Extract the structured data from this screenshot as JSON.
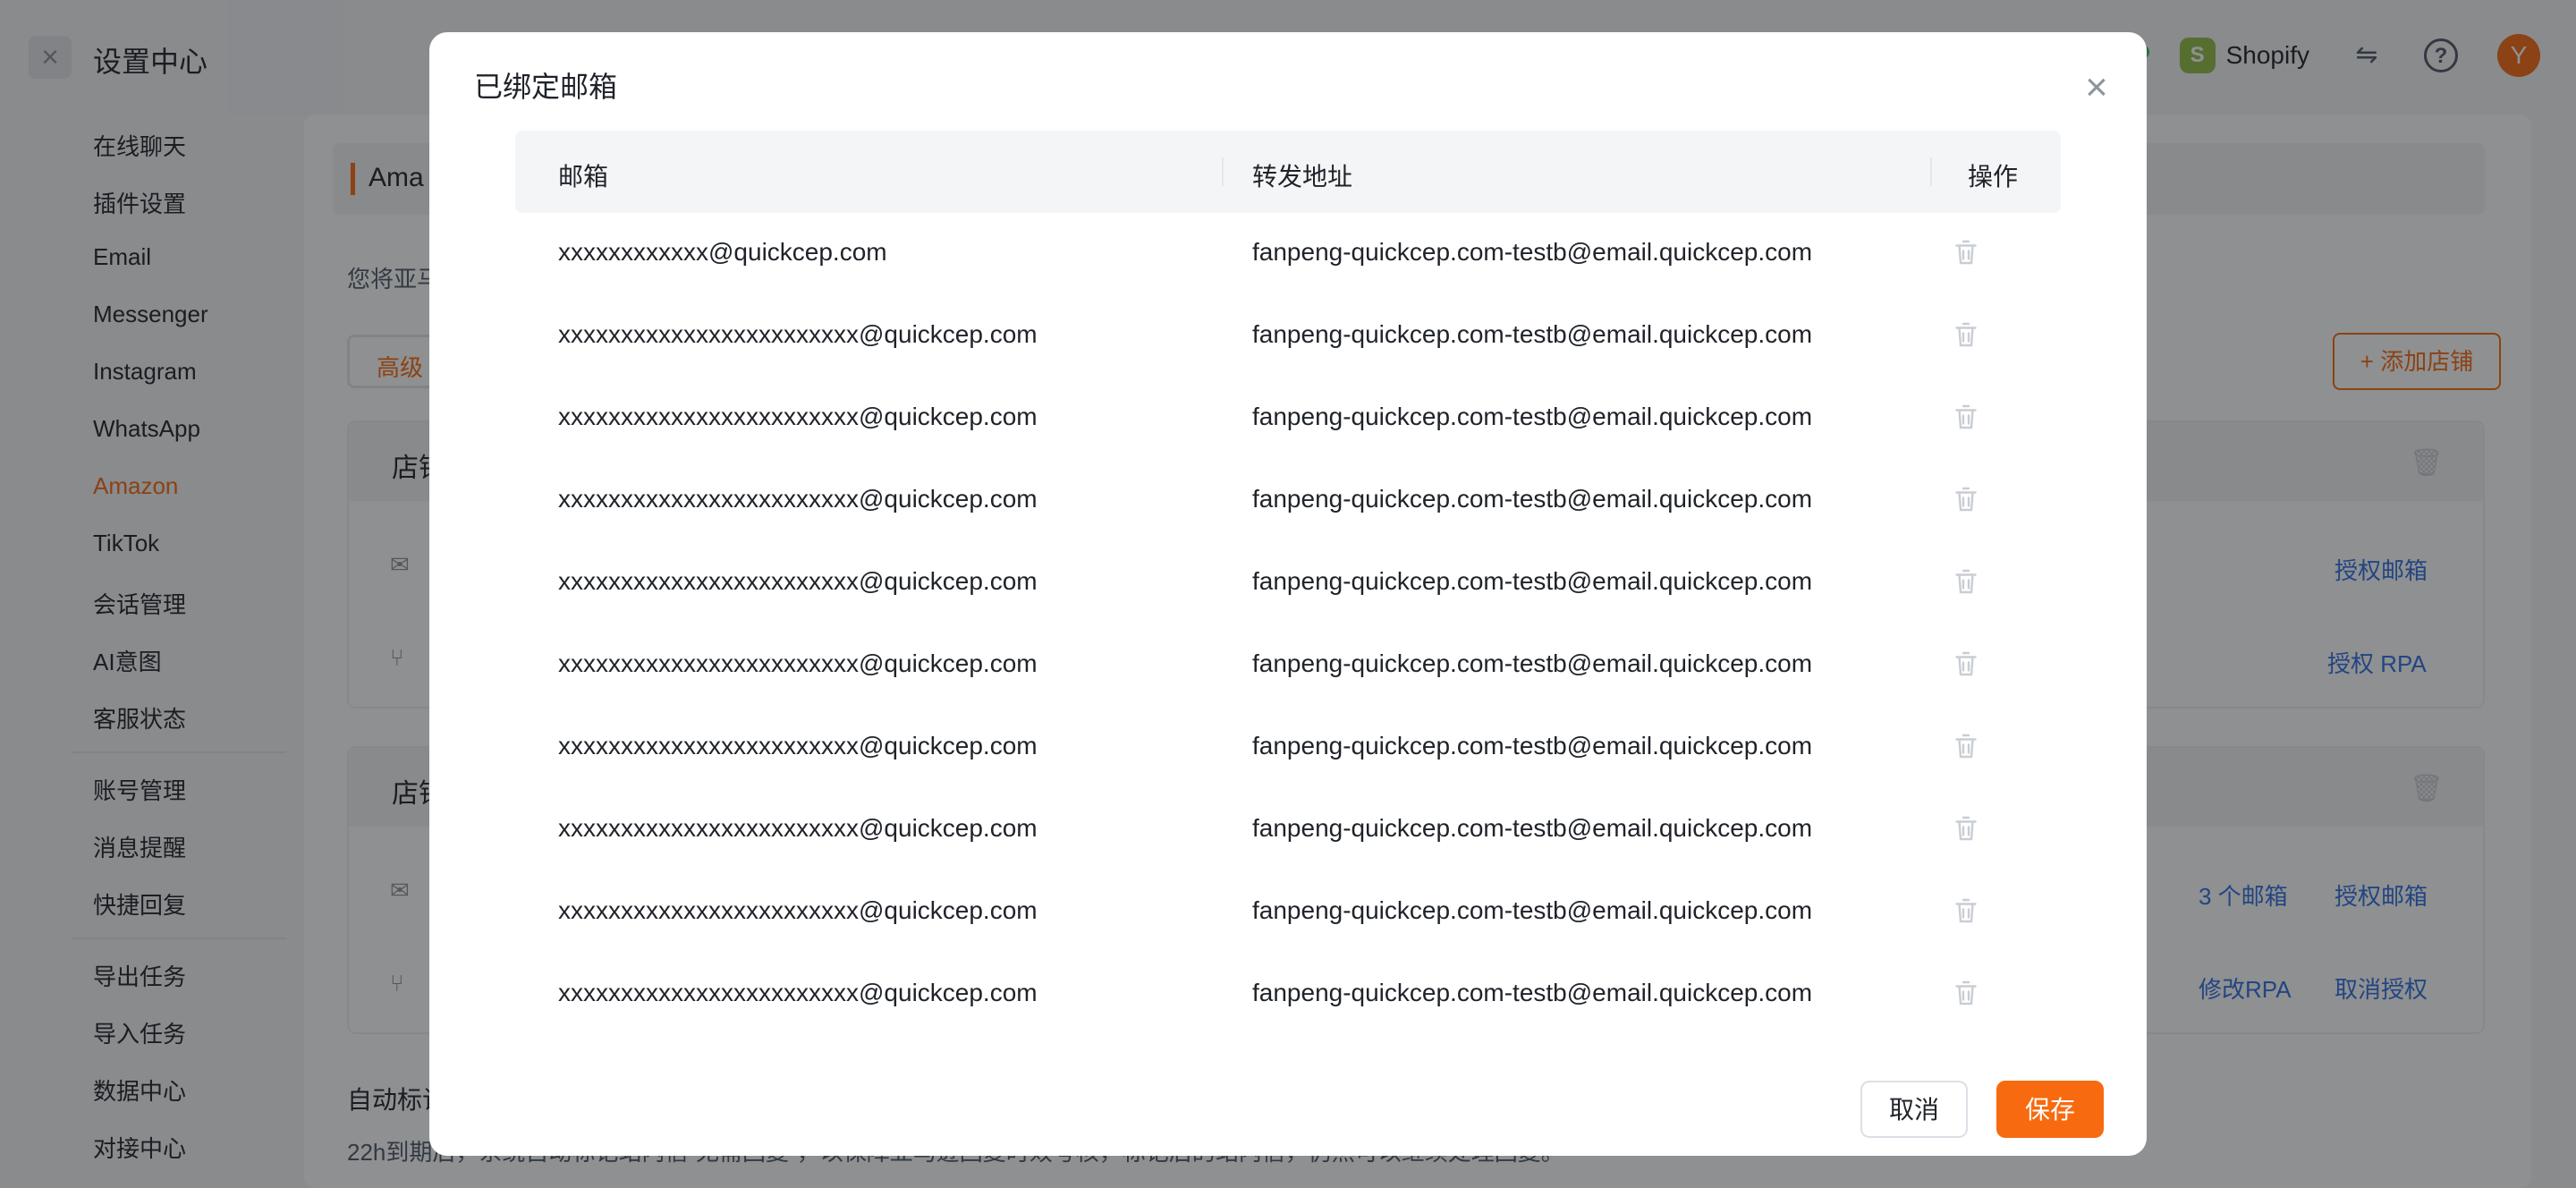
{
  "app": {
    "title": "设置中心",
    "shop_name": "Shopify",
    "avatar_letter": "Y"
  },
  "sidebar": {
    "items": [
      {
        "label": "在线聊天"
      },
      {
        "label": "插件设置"
      },
      {
        "label": "Email"
      },
      {
        "label": "Messenger"
      },
      {
        "label": "Instagram"
      },
      {
        "label": "WhatsApp"
      },
      {
        "label": "Amazon",
        "active": true
      },
      {
        "label": "TikTok"
      },
      {
        "label": "会话管理"
      },
      {
        "label": "AI意图"
      },
      {
        "label": "客服状态"
      },
      {
        "label": "账号管理"
      },
      {
        "label": "消息提醒"
      },
      {
        "label": "快捷回复"
      },
      {
        "label": "导出任务"
      },
      {
        "label": "导入任务"
      },
      {
        "label": "数据中心"
      },
      {
        "label": "对接中心"
      }
    ]
  },
  "main": {
    "header_visible": "Ama",
    "desc_visible": "您将亚马",
    "tab_visible": "高级",
    "add_store_label": "+ 添加店铺",
    "card1_title_visible": "店铺",
    "card1_link_email": "授权邮箱",
    "card1_link_rpa": "授权 RPA",
    "card2_title_visible": "店铺",
    "card2_emails_visible": "3 个邮箱",
    "card2_link_email": "授权邮箱",
    "card2_link_modify_rpa": "修改RPA",
    "card2_link_cancel": "取消授权",
    "auto_title_visible": "自动标记",
    "auto_desc_visible": "22h到期后，系统自动标记站内信“无需回复”，以保障亚马逊回复时效考核，标记后的站内信，仍然可以继续处理回复。"
  },
  "modal": {
    "title": "已绑定邮箱",
    "columns": {
      "email": "邮箱",
      "forward": "转发地址",
      "action": "操作"
    },
    "rows": [
      {
        "email": "xxxxxxxxxxxx@quickcep.com",
        "forward": "fanpeng-quickcep.com-testb@email.quickcep.com"
      },
      {
        "email": "xxxxxxxxxxxxxxxxxxxxxxxx@quickcep.com",
        "forward": "fanpeng-quickcep.com-testb@email.quickcep.com"
      },
      {
        "email": "xxxxxxxxxxxxxxxxxxxxxxxx@quickcep.com",
        "forward": "fanpeng-quickcep.com-testb@email.quickcep.com"
      },
      {
        "email": "xxxxxxxxxxxxxxxxxxxxxxxx@quickcep.com",
        "forward": "fanpeng-quickcep.com-testb@email.quickcep.com"
      },
      {
        "email": "xxxxxxxxxxxxxxxxxxxxxxxx@quickcep.com",
        "forward": "fanpeng-quickcep.com-testb@email.quickcep.com"
      },
      {
        "email": "xxxxxxxxxxxxxxxxxxxxxxxx@quickcep.com",
        "forward": "fanpeng-quickcep.com-testb@email.quickcep.com"
      },
      {
        "email": "xxxxxxxxxxxxxxxxxxxxxxxx@quickcep.com",
        "forward": "fanpeng-quickcep.com-testb@email.quickcep.com"
      },
      {
        "email": "xxxxxxxxxxxxxxxxxxxxxxxx@quickcep.com",
        "forward": "fanpeng-quickcep.com-testb@email.quickcep.com"
      },
      {
        "email": "xxxxxxxxxxxxxxxxxxxxxxxx@quickcep.com",
        "forward": "fanpeng-quickcep.com-testb@email.quickcep.com"
      },
      {
        "email": "xxxxxxxxxxxxxxxxxxxxxxxx@quickcep.com",
        "forward": "fanpeng-quickcep.com-testb@email.quickcep.com"
      }
    ],
    "cancel_label": "取消",
    "save_label": "保存"
  },
  "colors": {
    "accent": "#f76a10",
    "link": "#2f6fe4",
    "overlay": "rgba(20,22,26,0.48)"
  }
}
